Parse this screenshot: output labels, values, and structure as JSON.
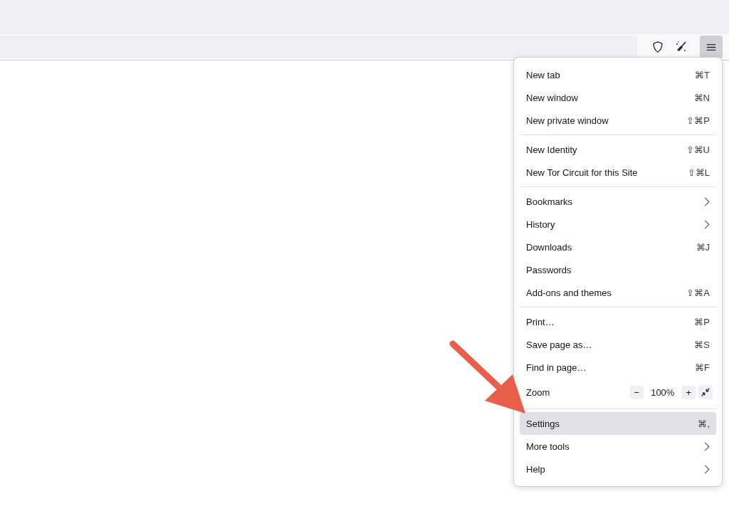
{
  "toolbar": {
    "menu_button": {
      "expanded": true
    }
  },
  "menu": {
    "groups": [
      [
        {
          "kind": "shortcut",
          "label": "New tab",
          "shortcut": "⌘T",
          "selected": false
        },
        {
          "kind": "shortcut",
          "label": "New window",
          "shortcut": "⌘N",
          "selected": false
        },
        {
          "kind": "shortcut",
          "label": "New private window",
          "shortcut": "⇧⌘P",
          "selected": false
        }
      ],
      [
        {
          "kind": "shortcut",
          "label": "New Identity",
          "shortcut": "⇧⌘U",
          "selected": false
        },
        {
          "kind": "shortcut",
          "label": "New Tor Circuit for this Site",
          "shortcut": "⇧⌘L",
          "selected": false
        }
      ],
      [
        {
          "kind": "submenu",
          "label": "Bookmarks",
          "selected": false
        },
        {
          "kind": "submenu",
          "label": "History",
          "selected": false
        },
        {
          "kind": "shortcut",
          "label": "Downloads",
          "shortcut": "⌘J",
          "selected": false
        },
        {
          "kind": "plain",
          "label": "Passwords",
          "selected": false
        },
        {
          "kind": "shortcut",
          "label": "Add-ons and themes",
          "shortcut": "⇧⌘A",
          "selected": false
        }
      ],
      [
        {
          "kind": "shortcut",
          "label": "Print…",
          "shortcut": "⌘P",
          "selected": false
        },
        {
          "kind": "shortcut",
          "label": "Save page as…",
          "shortcut": "⌘S",
          "selected": false
        },
        {
          "kind": "shortcut",
          "label": "Find in page…",
          "shortcut": "⌘F",
          "selected": false
        },
        {
          "kind": "zoom",
          "label": "Zoom",
          "minus": "−",
          "value": "100%",
          "plus": "+",
          "selected": false
        }
      ],
      [
        {
          "kind": "shortcut",
          "label": "Settings",
          "shortcut": "⌘,",
          "selected": true
        },
        {
          "kind": "submenu",
          "label": "More tools",
          "selected": false
        },
        {
          "kind": "submenu",
          "label": "Help",
          "selected": false
        }
      ]
    ]
  }
}
